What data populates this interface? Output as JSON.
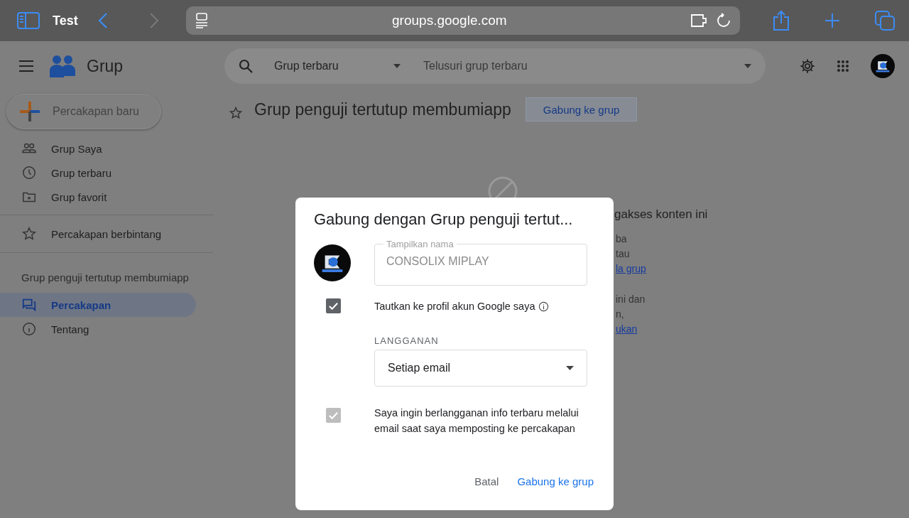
{
  "browser": {
    "tab_title": "Test",
    "url": "groups.google.com"
  },
  "app": {
    "title": "Grup",
    "search": {
      "scope": "Grup terbaru",
      "placeholder": "Telusuri grup terbaru"
    }
  },
  "sidebar": {
    "compose": "Percakapan baru",
    "nav": [
      {
        "label": "Grup Saya",
        "selected": false
      },
      {
        "label": "Grup terbaru",
        "selected": false
      },
      {
        "label": "Grup favorit",
        "selected": false
      }
    ],
    "starred": [
      {
        "label": "Percakapan berbintang",
        "selected": false
      }
    ],
    "group_name": "Grup penguji tertutup membumiapp",
    "group_nav": [
      {
        "label": "Percakapan",
        "selected": true
      },
      {
        "label": "Tentang",
        "selected": false
      }
    ]
  },
  "main": {
    "title": "Grup penguji tertutup membumiapp",
    "join_button": "Gabung ke grup",
    "notice": {
      "heading": "gakses konten ini",
      "paragraphs": [
        [
          {
            "text": "ba",
            "kind": "text"
          },
          {
            "text": "tau",
            "kind": "text"
          },
          {
            "text": "la grup",
            "kind": "link"
          }
        ],
        [
          {
            "text": "ini dan",
            "kind": "text"
          },
          {
            "text": "n,",
            "kind": "text"
          },
          {
            "text": "ukan",
            "kind": "link"
          }
        ]
      ]
    }
  },
  "dialog": {
    "title": "Gabung dengan Grup penguji tertut...",
    "name_field": {
      "label": "Tampilkan nama",
      "value": "CONSOLIX MIPLAY"
    },
    "link_profile": {
      "label": "Tautkan ke profil akun Google saya",
      "checked": true,
      "disabled": false
    },
    "subscription": {
      "label": "LANGGANAN",
      "value": "Setiap email"
    },
    "notify": {
      "label": "Saya ingin berlangganan info terbaru melalui email saat saya memposting ke percakapan",
      "checked": true,
      "disabled": true
    },
    "buttons": [
      {
        "label": "Batal",
        "kind": "secondary"
      },
      {
        "label": "Gabung ke grup",
        "kind": "primary"
      }
    ]
  }
}
